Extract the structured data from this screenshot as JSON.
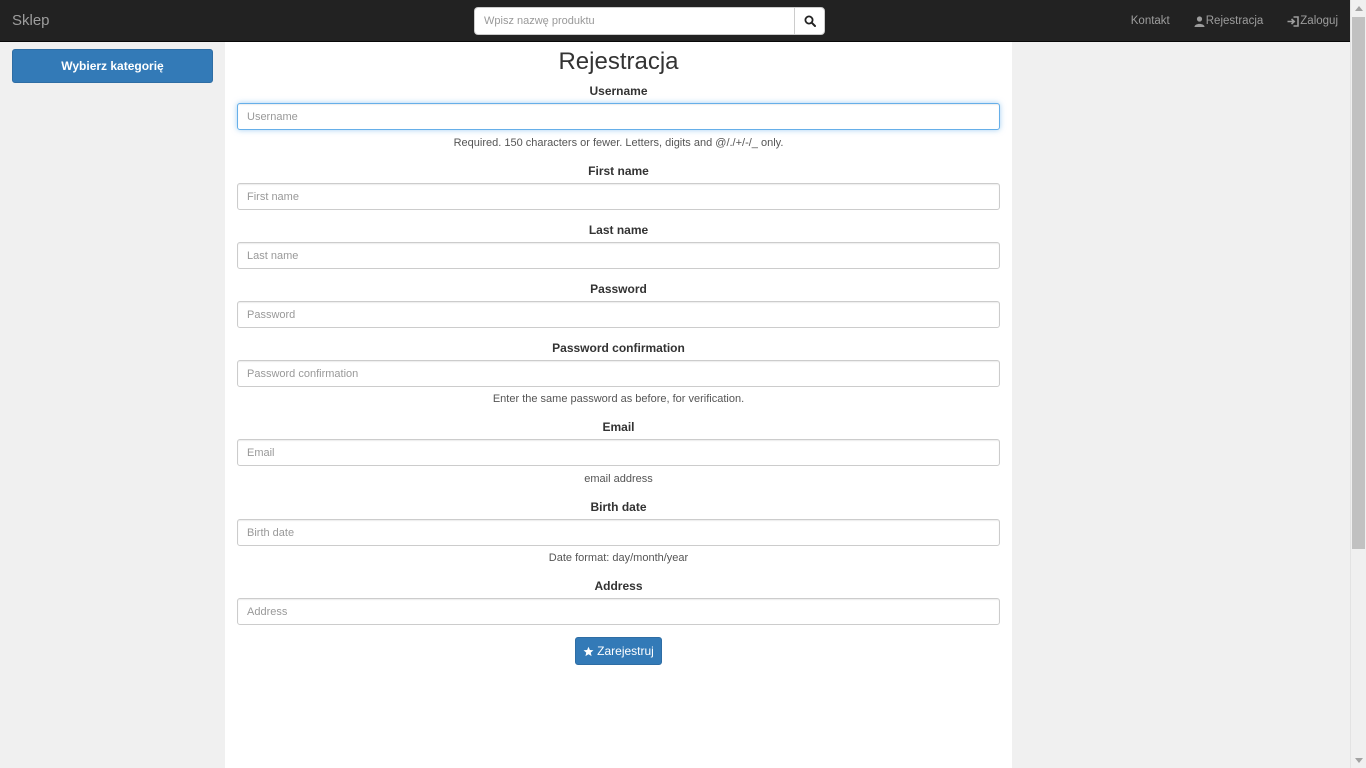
{
  "navbar": {
    "brand": "Sklep",
    "search_placeholder": "Wpisz nazwę produktu",
    "links": {
      "contact": "Kontakt",
      "register": "Rejestracja",
      "login": "Zaloguj"
    }
  },
  "sidebar": {
    "category_button": "Wybierz kategorię"
  },
  "form": {
    "title": "Rejestracja",
    "username": {
      "label": "Username",
      "placeholder": "Username",
      "help": "Required. 150 characters or fewer. Letters, digits and @/./+/-/_ only."
    },
    "first_name": {
      "label": "First name",
      "placeholder": "First name"
    },
    "last_name": {
      "label": "Last name",
      "placeholder": "Last name"
    },
    "password": {
      "label": "Password",
      "placeholder": "Password"
    },
    "password_confirmation": {
      "label": "Password confirmation",
      "placeholder": "Password confirmation",
      "help": "Enter the same password as before, for verification."
    },
    "email": {
      "label": "Email",
      "placeholder": "Email",
      "help": "email address"
    },
    "birth_date": {
      "label": "Birth date",
      "placeholder": "Birth date",
      "help": "Date format: day/month/year"
    },
    "address": {
      "label": "Address",
      "placeholder": "Address"
    },
    "submit": "Zarejestruj"
  },
  "icons": {
    "search": "search-icon",
    "user": "user-icon",
    "login": "log-in-icon",
    "star": "star-icon"
  },
  "colors": {
    "navbar_bg": "#222222",
    "primary": "#337ab7",
    "page_bg": "#f0f0f0",
    "panel_bg": "#ffffff",
    "focus": "#66afe9"
  }
}
